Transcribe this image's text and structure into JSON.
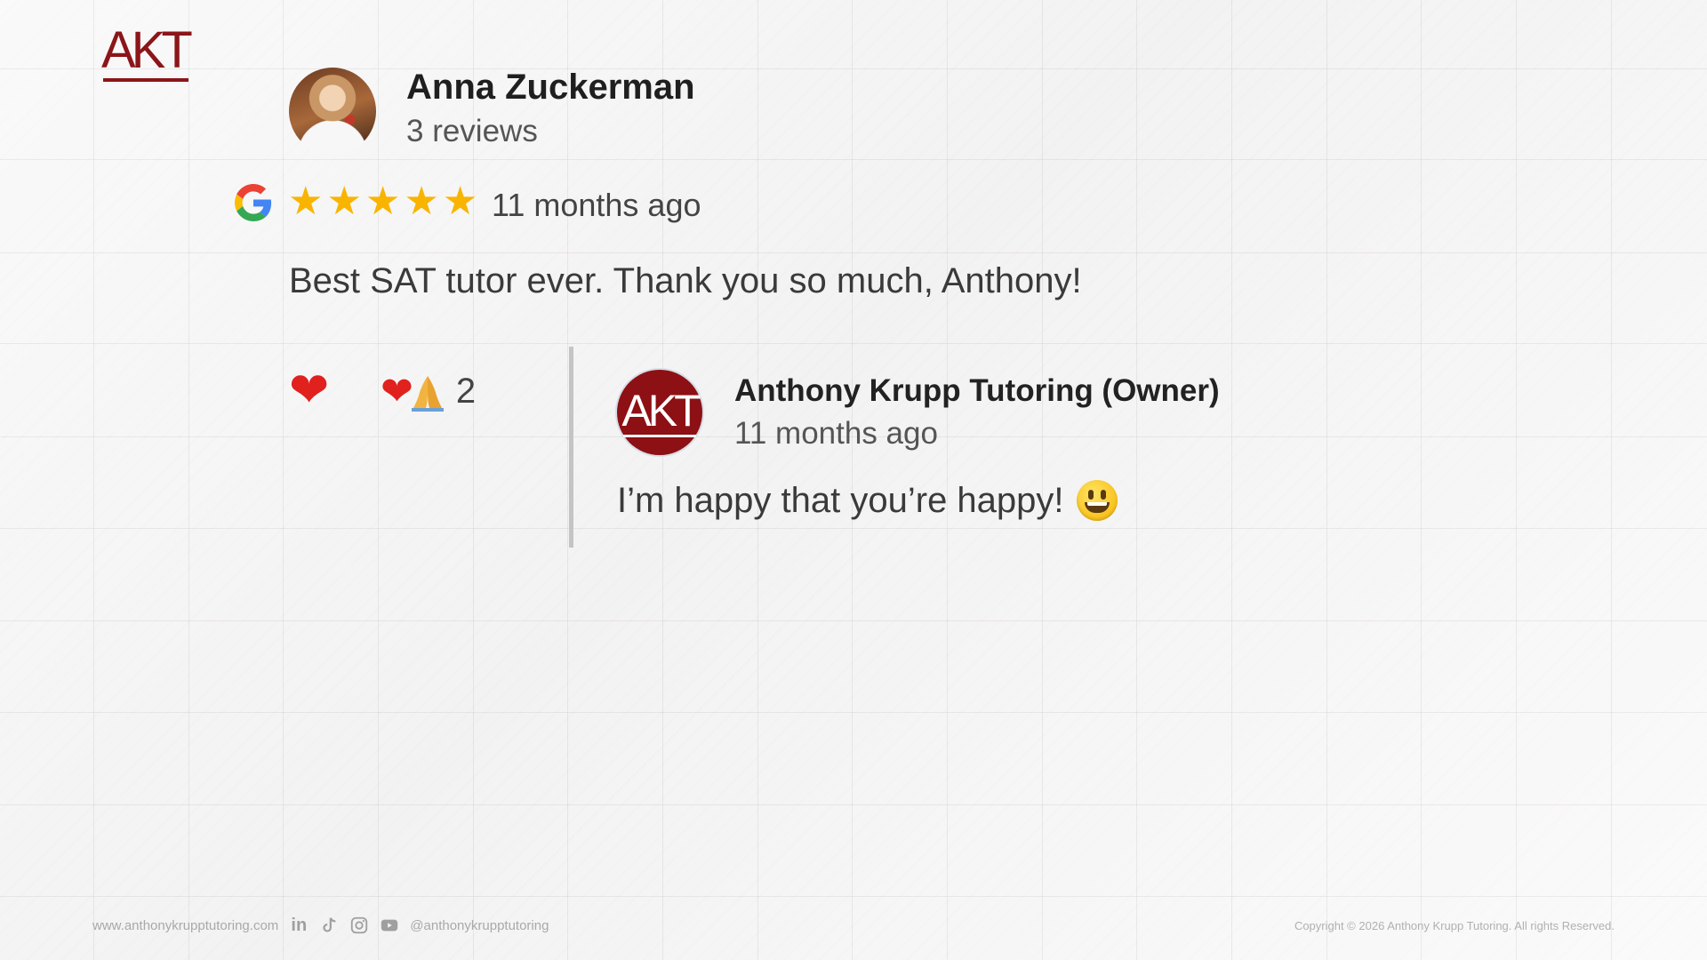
{
  "brand": {
    "logo_text": "AKT",
    "color": "#8b1518"
  },
  "review": {
    "reviewer_name": "Anna Zuckerman",
    "reviewer_reviews": "3 reviews",
    "source_icon": "google-g-icon",
    "rating": 5,
    "max_rating": 5,
    "star_color": "#f9b400",
    "date": "11 months ago",
    "text": "Best SAT tutor ever. Thank you so much, Anthony!",
    "reactions": {
      "primary_icon": "heart-icon",
      "group_icons": [
        "heart-icon",
        "folded-hands-icon"
      ],
      "count": "2"
    }
  },
  "owner_reply": {
    "name": "Anthony Krupp Tutoring (Owner)",
    "avatar_text": "AKT",
    "date": "11 months ago",
    "text": "I’m happy that you’re happy!",
    "emoji_icon": "grinning-face-icon"
  },
  "footer": {
    "website": "www.anthonykrupptutoring.com",
    "social_icons": [
      "linkedin-icon",
      "tiktok-icon",
      "instagram-icon",
      "youtube-icon"
    ],
    "handle": "@anthonykrupptutoring",
    "copyright": "Copyright © 2026 Anthony Krupp Tutoring. All rights Reserved."
  }
}
